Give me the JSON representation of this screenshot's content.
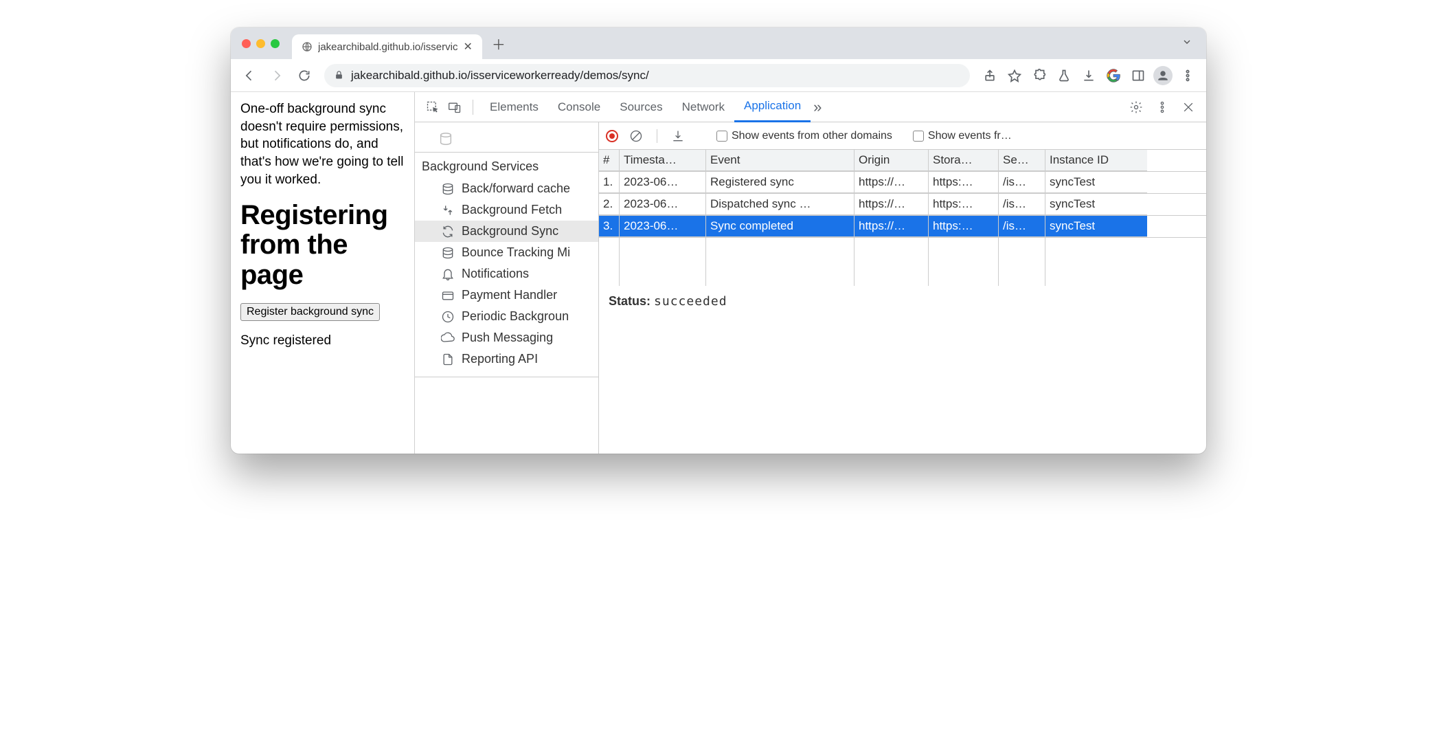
{
  "tab": {
    "title": "jakearchibald.github.io/isservic"
  },
  "omnibox": {
    "url": "jakearchibald.github.io/isserviceworkerready/demos/sync/"
  },
  "page": {
    "intro": "One-off background sync doesn't require permissions, but notifications do, and that's how we're going to tell you it worked.",
    "heading": "Registering from the page",
    "button": "Register background sync",
    "status": "Sync registered"
  },
  "devtools": {
    "tabs": [
      "Elements",
      "Console",
      "Sources",
      "Network",
      "Application"
    ],
    "active_tab": "Application",
    "toolbar": {
      "checkbox1": "Show events from other domains",
      "checkbox2": "Show events fr…"
    },
    "sidebar": {
      "section": "Background Services",
      "items": [
        "Back/forward cache",
        "Background Fetch",
        "Background Sync",
        "Bounce Tracking Mi",
        "Notifications",
        "Payment Handler",
        "Periodic Backgroun",
        "Push Messaging",
        "Reporting API"
      ],
      "selected": 2
    },
    "table": {
      "headers": [
        "#",
        "Timesta…",
        "Event",
        "Origin",
        "Stora…",
        "Se…",
        "Instance ID"
      ],
      "rows": [
        {
          "num": "1.",
          "ts": "2023-06…",
          "event": "Registered sync",
          "origin": "https://…",
          "storage": "https:…",
          "scope": "/is…",
          "instance": "syncTest"
        },
        {
          "num": "2.",
          "ts": "2023-06…",
          "event": "Dispatched sync …",
          "origin": "https://…",
          "storage": "https:…",
          "scope": "/is…",
          "instance": "syncTest"
        },
        {
          "num": "3.",
          "ts": "2023-06…",
          "event": "Sync completed",
          "origin": "https://…",
          "storage": "https:…",
          "scope": "/is…",
          "instance": "syncTest"
        }
      ],
      "selected_row": 2
    },
    "status": {
      "label": "Status:",
      "value": "succeeded"
    }
  }
}
